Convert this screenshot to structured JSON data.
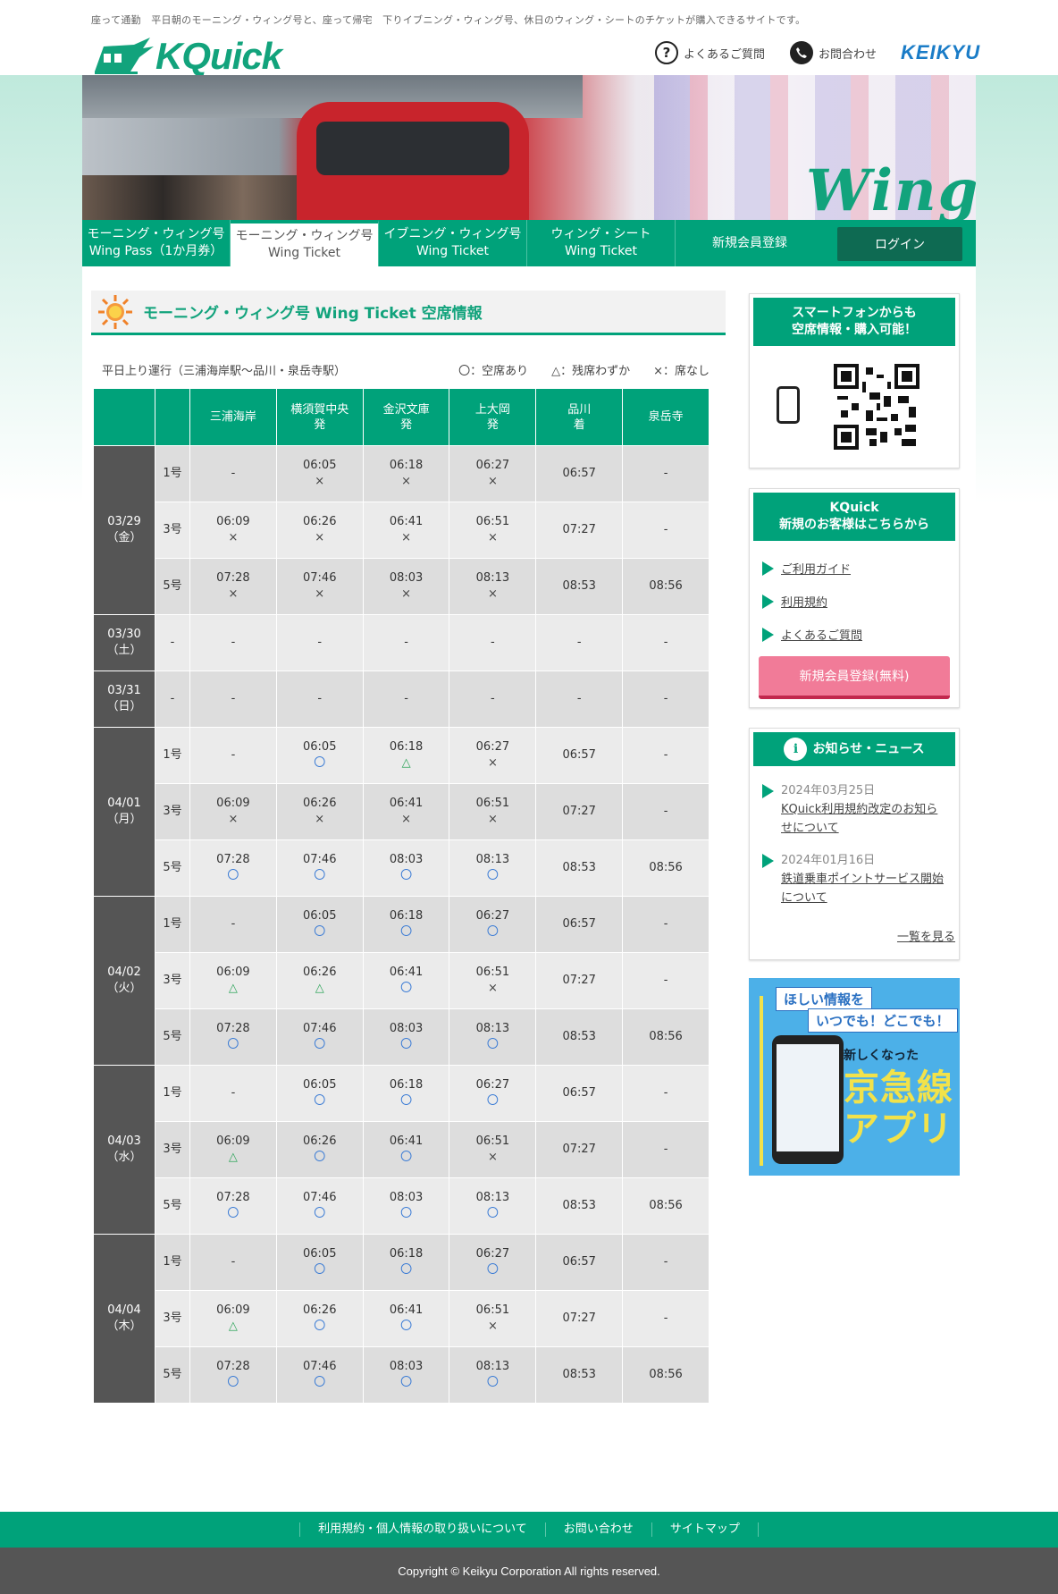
{
  "header": {
    "tagline": "座って通勤　平日朝のモーニング・ウィング号と、座って帰宅　下りイブニング・ウィング号、休日のウィング・シートのチケットが購入できるサイトです。",
    "logo_text": "KQuick",
    "faq_label": "よくあるご質問",
    "contact_label": "お問合わせ",
    "brand": "KEIKYU",
    "banner_text": "Wing"
  },
  "nav": {
    "items": [
      {
        "line1": "モーニング・ウィング号",
        "line2": "Wing Pass（1か月券）"
      },
      {
        "line1": "モーニング・ウィング号",
        "line2": "Wing Ticket"
      },
      {
        "line1": "イブニング・ウィング号",
        "line2": "Wing Ticket"
      },
      {
        "line1": "ウィング・シート",
        "line2": "Wing Ticket"
      },
      {
        "line1": "新規会員登録",
        "line2": ""
      }
    ],
    "login": "ログイン"
  },
  "main": {
    "title": "モーニング・ウィング号 Wing Ticket 空席情報",
    "route": "平日上り運行（三浦海岸駅～品川・泉岳寺駅）",
    "legend": [
      "〇：空席あり",
      "△：残席わずか",
      "×：席なし"
    ],
    "headers": [
      "",
      "",
      "三浦海岸",
      "横須賀中央\n発",
      "金沢文庫\n発",
      "上大岡\n発",
      "品川\n着",
      "泉岳寺"
    ],
    "days": [
      {
        "date": "03/29\n（金）",
        "rows": [
          {
            "no": "1号",
            "cells": [
              [
                "-",
                ""
              ],
              [
                "06:05",
                "x"
              ],
              [
                "06:18",
                "x"
              ],
              [
                "06:27",
                "x"
              ],
              [
                "06:57",
                ""
              ],
              [
                "-",
                ""
              ]
            ]
          },
          {
            "no": "3号",
            "cells": [
              [
                "06:09",
                "x"
              ],
              [
                "06:26",
                "x"
              ],
              [
                "06:41",
                "x"
              ],
              [
                "06:51",
                "x"
              ],
              [
                "07:27",
                ""
              ],
              [
                "-",
                ""
              ]
            ]
          },
          {
            "no": "5号",
            "cells": [
              [
                "07:28",
                "x"
              ],
              [
                "07:46",
                "x"
              ],
              [
                "08:03",
                "x"
              ],
              [
                "08:13",
                "x"
              ],
              [
                "08:53",
                ""
              ],
              [
                "08:56",
                ""
              ]
            ]
          }
        ]
      },
      {
        "date": "03/30\n（土）",
        "rows": [
          {
            "no": "-",
            "cells": [
              [
                "-",
                ""
              ],
              [
                "-",
                ""
              ],
              [
                "-",
                ""
              ],
              [
                "-",
                ""
              ],
              [
                "-",
                ""
              ],
              [
                "-",
                ""
              ]
            ]
          }
        ]
      },
      {
        "date": "03/31\n（日）",
        "rows": [
          {
            "no": "-",
            "cells": [
              [
                "-",
                ""
              ],
              [
                "-",
                ""
              ],
              [
                "-",
                ""
              ],
              [
                "-",
                ""
              ],
              [
                "-",
                ""
              ],
              [
                "-",
                ""
              ]
            ]
          }
        ]
      },
      {
        "date": "04/01\n（月）",
        "rows": [
          {
            "no": "1号",
            "cells": [
              [
                "-",
                ""
              ],
              [
                "06:05",
                "o"
              ],
              [
                "06:18",
                "t"
              ],
              [
                "06:27",
                "x"
              ],
              [
                "06:57",
                ""
              ],
              [
                "-",
                ""
              ]
            ]
          },
          {
            "no": "3号",
            "cells": [
              [
                "06:09",
                "x"
              ],
              [
                "06:26",
                "x"
              ],
              [
                "06:41",
                "x"
              ],
              [
                "06:51",
                "x"
              ],
              [
                "07:27",
                ""
              ],
              [
                "-",
                ""
              ]
            ]
          },
          {
            "no": "5号",
            "cells": [
              [
                "07:28",
                "o"
              ],
              [
                "07:46",
                "o"
              ],
              [
                "08:03",
                "o"
              ],
              [
                "08:13",
                "o"
              ],
              [
                "08:53",
                ""
              ],
              [
                "08:56",
                ""
              ]
            ]
          }
        ]
      },
      {
        "date": "04/02\n（火）",
        "rows": [
          {
            "no": "1号",
            "cells": [
              [
                "-",
                ""
              ],
              [
                "06:05",
                "o"
              ],
              [
                "06:18",
                "o"
              ],
              [
                "06:27",
                "o"
              ],
              [
                "06:57",
                ""
              ],
              [
                "-",
                ""
              ]
            ]
          },
          {
            "no": "3号",
            "cells": [
              [
                "06:09",
                "t"
              ],
              [
                "06:26",
                "t"
              ],
              [
                "06:41",
                "o"
              ],
              [
                "06:51",
                "x"
              ],
              [
                "07:27",
                ""
              ],
              [
                "-",
                ""
              ]
            ]
          },
          {
            "no": "5号",
            "cells": [
              [
                "07:28",
                "o"
              ],
              [
                "07:46",
                "o"
              ],
              [
                "08:03",
                "o"
              ],
              [
                "08:13",
                "o"
              ],
              [
                "08:53",
                ""
              ],
              [
                "08:56",
                ""
              ]
            ]
          }
        ]
      },
      {
        "date": "04/03\n（水）",
        "rows": [
          {
            "no": "1号",
            "cells": [
              [
                "-",
                ""
              ],
              [
                "06:05",
                "o"
              ],
              [
                "06:18",
                "o"
              ],
              [
                "06:27",
                "o"
              ],
              [
                "06:57",
                ""
              ],
              [
                "-",
                ""
              ]
            ]
          },
          {
            "no": "3号",
            "cells": [
              [
                "06:09",
                "t"
              ],
              [
                "06:26",
                "o"
              ],
              [
                "06:41",
                "o"
              ],
              [
                "06:51",
                "x"
              ],
              [
                "07:27",
                ""
              ],
              [
                "-",
                ""
              ]
            ]
          },
          {
            "no": "5号",
            "cells": [
              [
                "07:28",
                "o"
              ],
              [
                "07:46",
                "o"
              ],
              [
                "08:03",
                "o"
              ],
              [
                "08:13",
                "o"
              ],
              [
                "08:53",
                ""
              ],
              [
                "08:56",
                ""
              ]
            ]
          }
        ]
      },
      {
        "date": "04/04\n（木）",
        "rows": [
          {
            "no": "1号",
            "cells": [
              [
                "-",
                ""
              ],
              [
                "06:05",
                "o"
              ],
              [
                "06:18",
                "o"
              ],
              [
                "06:27",
                "o"
              ],
              [
                "06:57",
                ""
              ],
              [
                "-",
                ""
              ]
            ]
          },
          {
            "no": "3号",
            "cells": [
              [
                "06:09",
                "t"
              ],
              [
                "06:26",
                "o"
              ],
              [
                "06:41",
                "o"
              ],
              [
                "06:51",
                "x"
              ],
              [
                "07:27",
                ""
              ],
              [
                "-",
                ""
              ]
            ]
          },
          {
            "no": "5号",
            "cells": [
              [
                "07:28",
                "o"
              ],
              [
                "07:46",
                "o"
              ],
              [
                "08:03",
                "o"
              ],
              [
                "08:13",
                "o"
              ],
              [
                "08:53",
                ""
              ],
              [
                "08:56",
                ""
              ]
            ]
          }
        ]
      }
    ],
    "marks": {
      "o": "〇",
      "t": "△",
      "x": "×"
    }
  },
  "sidebar": {
    "smartphone_title": "スマートフォンからも\n空席情報・購入可能！",
    "newuser_title": "KQuick\n新規のお客様はこちらから",
    "links": [
      "ご利用ガイド",
      "利用規約",
      "よくあるご質問"
    ],
    "register_button": "新規会員登録(無料)",
    "news_title": "お知らせ・ニュース",
    "news": [
      {
        "date": "2024年03月25日",
        "text": "KQuick利用規約改定のお知らせについて"
      },
      {
        "date": "2024年01月16日",
        "text": "鉄道乗車ポイントサービス開始について"
      }
    ],
    "more": "一覧を見る",
    "ad": {
      "line1": "ほしい情報を",
      "line2": "いつでも！どこでも！",
      "small": "新しくなった",
      "big1": "京急線",
      "big2": "アプリ"
    }
  },
  "footer": {
    "links": [
      "利用規約・個人情報の取り扱いについて",
      "お問い合わせ",
      "サイトマップ"
    ],
    "copyright": "Copyright © Keikyu Corporation All rights reserved."
  },
  "colors": {
    "brand_green": "#00a27a",
    "dark_green": "#0e6a52",
    "pink": "#f17b98",
    "date_gray": "#555555"
  }
}
